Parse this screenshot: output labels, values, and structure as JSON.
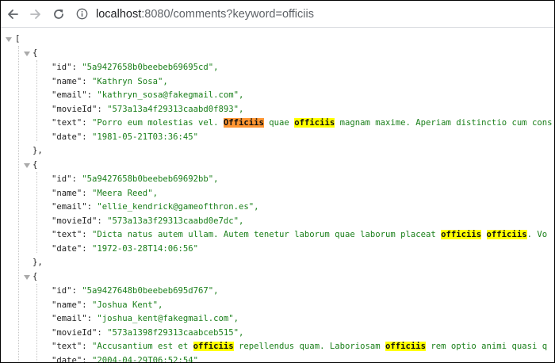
{
  "browser": {
    "url_host": "localhost",
    "url_rest": ":8080/comments?keyword=officiis"
  },
  "json_view": {
    "open_bracket": "[",
    "open_brace": "{",
    "close_brace": "},",
    "records": [
      {
        "id": "5a9427658b0beebeb69695cd",
        "name": "Kathryn Sosa",
        "email": "kathryn_sosa@fakegmail.com",
        "movieId": "573a13a4f29313caabd0f893",
        "text_segments": [
          {
            "t": "Porro eum molestias vel. ",
            "hl": "none"
          },
          {
            "t": "Officiis",
            "hl": "active"
          },
          {
            "t": " quae ",
            "hl": "none"
          },
          {
            "t": "officiis",
            "hl": "match"
          },
          {
            "t": " magnam maxime. Aperiam distinctio cum cons",
            "hl": "none"
          }
        ],
        "date": "1981-05-21T03:36:45"
      },
      {
        "id": "5a9427658b0beebeb69692bb",
        "name": "Meera Reed",
        "email": "ellie_kendrick@gameofthron.es",
        "movieId": "573a13a3f29313caabd0e7dc",
        "text_segments": [
          {
            "t": "Dicta natus autem ullam. Autem tenetur laborum quae laborum placeat ",
            "hl": "none"
          },
          {
            "t": "officiis",
            "hl": "match"
          },
          {
            "t": " ",
            "hl": "none"
          },
          {
            "t": "officiis",
            "hl": "match"
          },
          {
            "t": ". Vo",
            "hl": "none"
          }
        ],
        "date": "1972-03-28T14:06:56"
      },
      {
        "id": "5a9427648b0beebeb695d767",
        "name": "Joshua Kent",
        "email": "joshua_kent@fakegmail.com",
        "movieId": "573a1398f29313caabceb515",
        "text_segments": [
          {
            "t": "Accusantium est et ",
            "hl": "none"
          },
          {
            "t": "officiis",
            "hl": "match"
          },
          {
            "t": " repellendus quam. Laboriosam ",
            "hl": "none"
          },
          {
            "t": "officiis",
            "hl": "match"
          },
          {
            "t": " rem optio animi quasi q",
            "hl": "none"
          }
        ],
        "date": "2004-04-29T06:52:54"
      }
    ]
  }
}
